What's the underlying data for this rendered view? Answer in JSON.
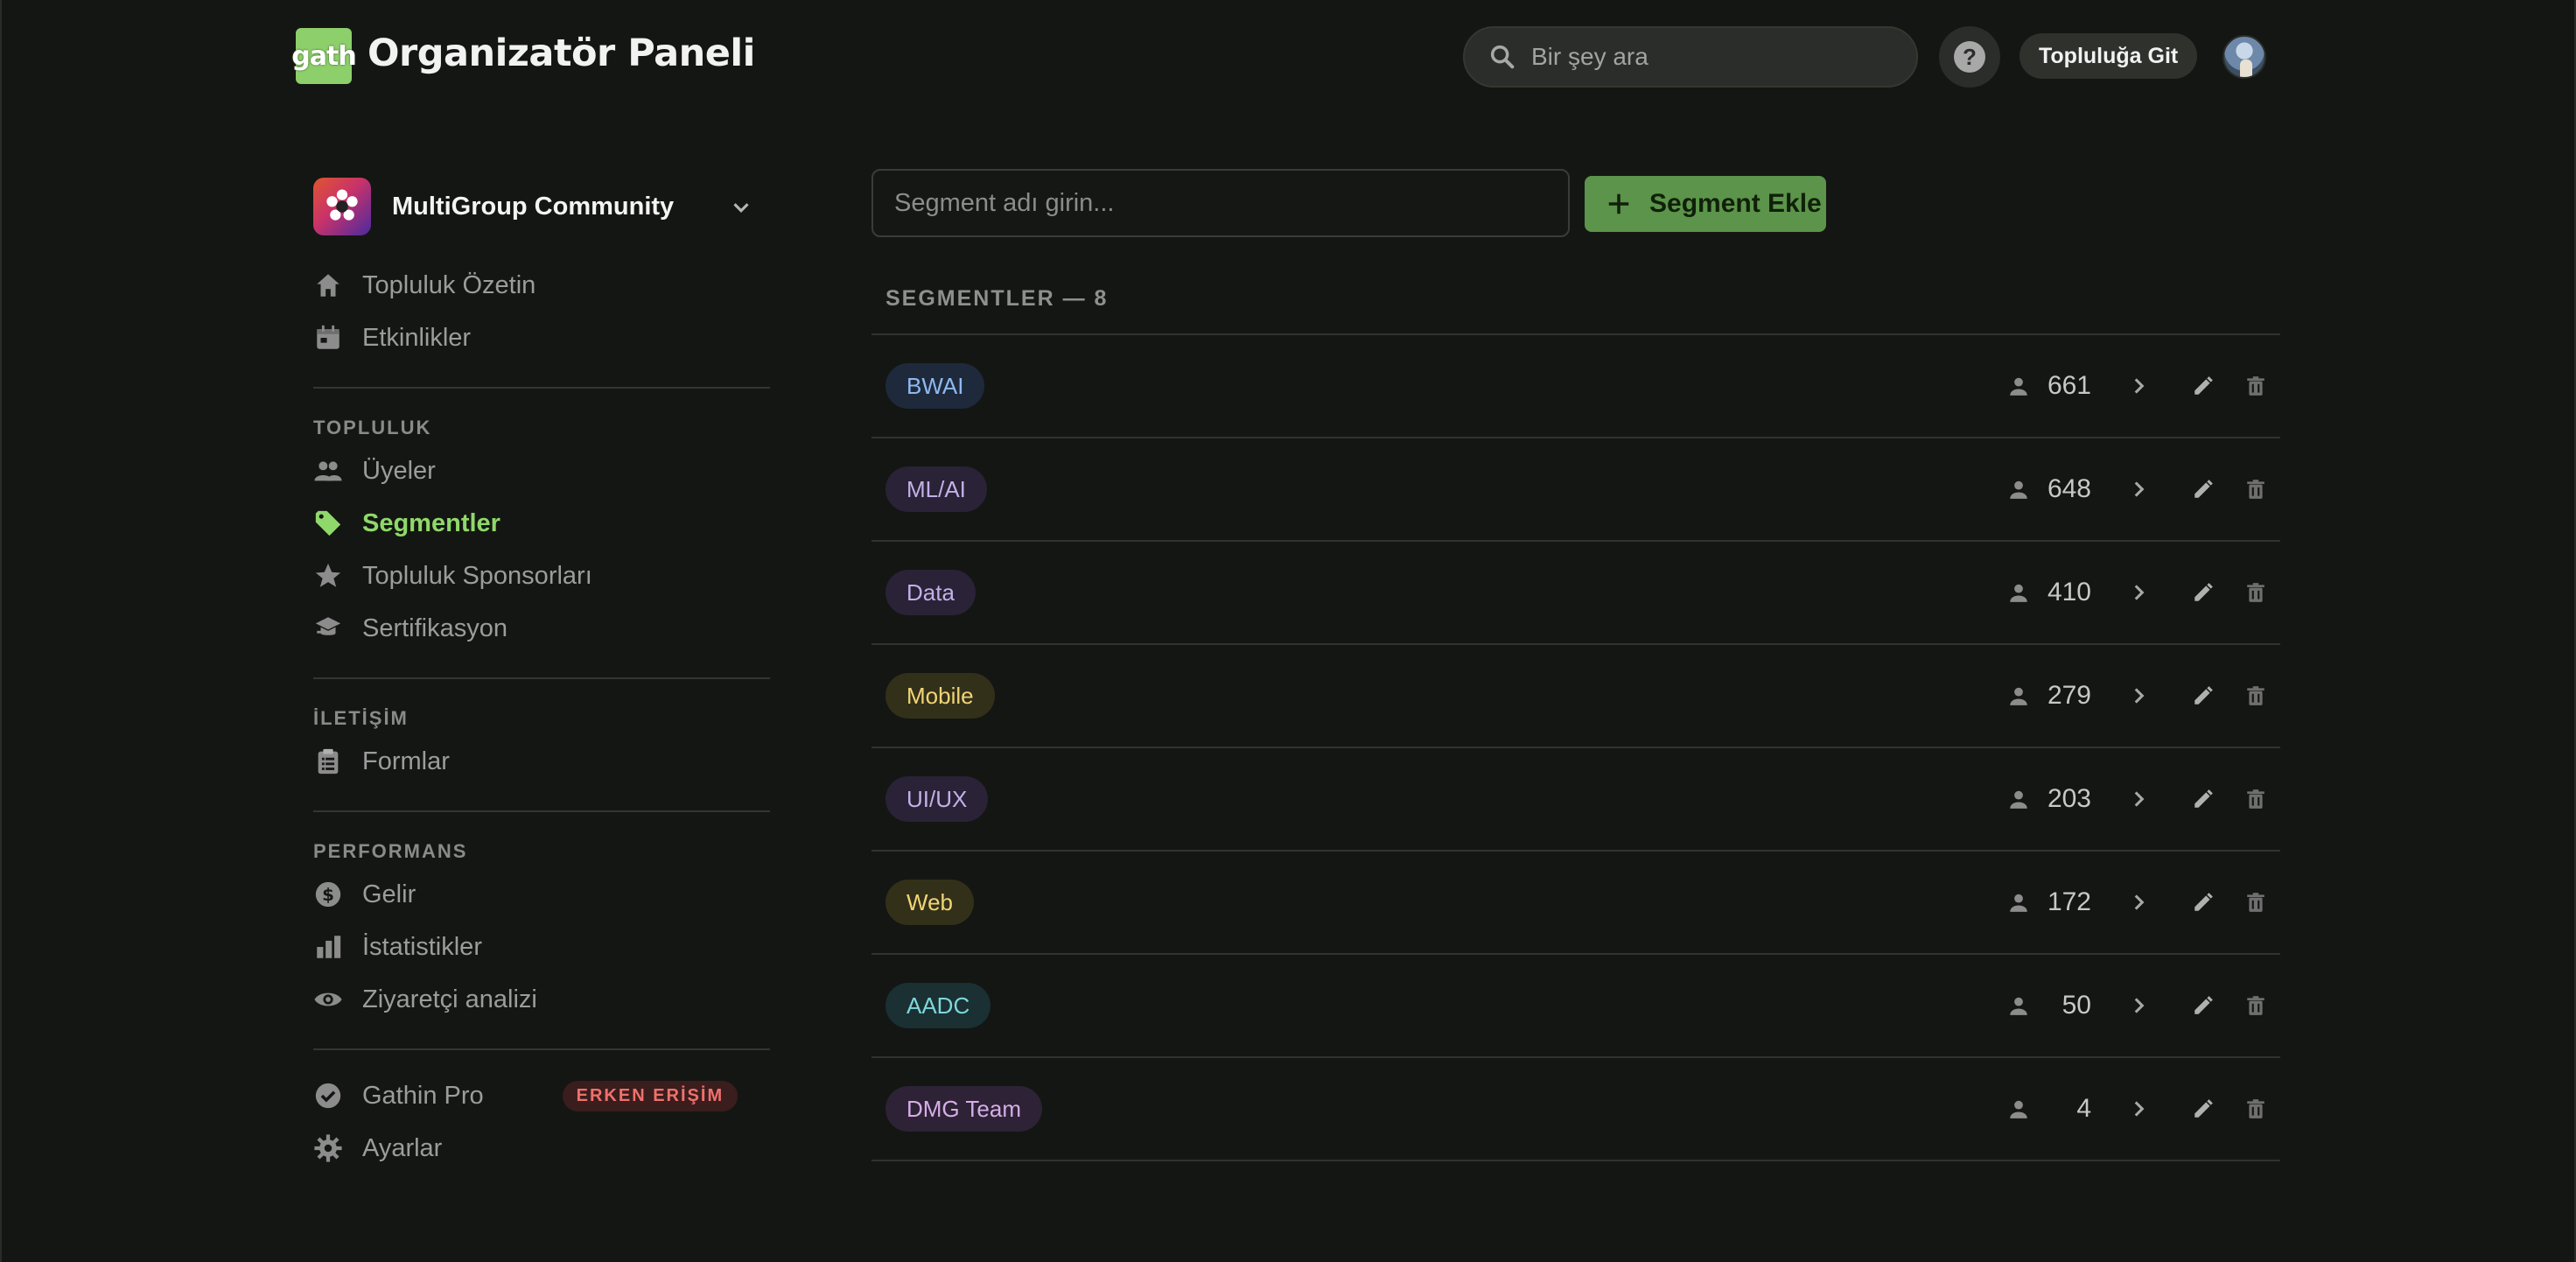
{
  "header": {
    "logo_text": "gath",
    "title": "Organizatör Paneli",
    "search_placeholder": "Bir şey ara",
    "community_button": "Topluluğa Git"
  },
  "sidebar": {
    "org_name": "MultiGroup Community",
    "top_items": [
      {
        "label": "Topluluk Özetin",
        "icon": "home-icon"
      },
      {
        "label": "Etkinlikler",
        "icon": "calendar-icon"
      }
    ],
    "section_topluluk": "TOPLULUK",
    "topluluk_items": [
      {
        "label": "Üyeler",
        "icon": "people-icon"
      },
      {
        "label": "Segmentler",
        "icon": "tag-icon",
        "active": true
      },
      {
        "label": "Topluluk Sponsorları",
        "icon": "star-icon"
      },
      {
        "label": "Sertifikasyon",
        "icon": "certificate-icon"
      }
    ],
    "section_iletisim": "İLETİŞİM",
    "iletisim_items": [
      {
        "label": "Formlar",
        "icon": "clipboard-icon"
      }
    ],
    "section_performans": "PERFORMANS",
    "performans_items": [
      {
        "label": "Gelir",
        "icon": "dollar-icon"
      },
      {
        "label": "İstatistikler",
        "icon": "bar-chart-icon"
      },
      {
        "label": "Ziyaretçi analizi",
        "icon": "eye-icon"
      }
    ],
    "bottom_items": [
      {
        "label": "Gathin Pro",
        "icon": "verified-icon",
        "badge": "ERKEN ERİŞİM"
      },
      {
        "label": "Ayarlar",
        "icon": "gear-icon"
      }
    ]
  },
  "main": {
    "segment_input_placeholder": "Segment adı girin...",
    "add_button": "Segment Ekle",
    "count_label": "SEGMENTLER — 8",
    "segments": [
      {
        "name": "BWAI",
        "count": "661",
        "bg": "#1e2a3b",
        "fg": "#8fb9f0"
      },
      {
        "name": "ML/AI",
        "count": "648",
        "bg": "#2a2236",
        "fg": "#c2b0e8"
      },
      {
        "name": "Data",
        "count": "410",
        "bg": "#2a2236",
        "fg": "#c2b0e8"
      },
      {
        "name": "Mobile",
        "count": "279",
        "bg": "#33301a",
        "fg": "#f0d576"
      },
      {
        "name": "UI/UX",
        "count": "203",
        "bg": "#2a2236",
        "fg": "#c2b0e8"
      },
      {
        "name": "Web",
        "count": "172",
        "bg": "#33301a",
        "fg": "#f0d576"
      },
      {
        "name": "AADC",
        "count": "50",
        "bg": "#1a3033",
        "fg": "#7fd6da"
      },
      {
        "name": "DMG Team",
        "count": "4",
        "bg": "#2e2236",
        "fg": "#d4aee6"
      }
    ]
  }
}
